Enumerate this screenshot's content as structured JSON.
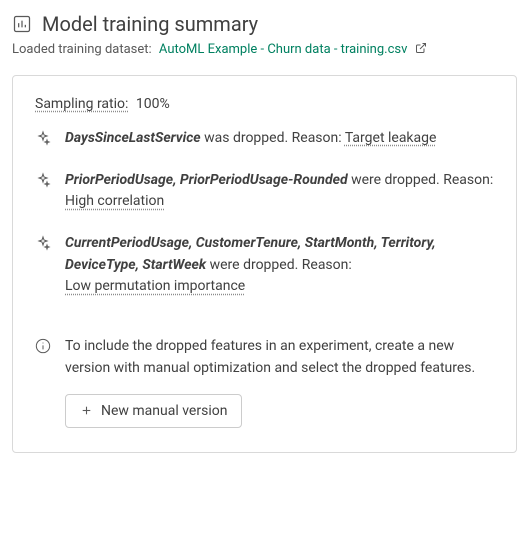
{
  "header": {
    "title": "Model training summary"
  },
  "dataset": {
    "label": "Loaded training dataset:",
    "link_text": "AutoML Example - Churn data - training.csv"
  },
  "sampling": {
    "label": "Sampling ratio:",
    "value": "100%"
  },
  "drops": [
    {
      "features": "DaysSinceLastService",
      "verb": " was dropped. Reason: ",
      "reason": "Target leakage",
      "reason_block": false
    },
    {
      "features": "PriorPeriodUsage, PriorPeriodUsage-Rounded",
      "verb": " were dropped. Reason:",
      "reason": "High correlation",
      "reason_block": true
    },
    {
      "features": "CurrentPeriodUsage, CustomerTenure, StartMonth, Territory, DeviceType, StartWeek",
      "verb": " were dropped. Reason:",
      "reason": "Low permutation importance",
      "reason_block": true
    }
  ],
  "info": {
    "text": "To include the dropped features in an experiment, create a new version with manual optimization and select the dropped features.",
    "button_label": "New manual version"
  }
}
